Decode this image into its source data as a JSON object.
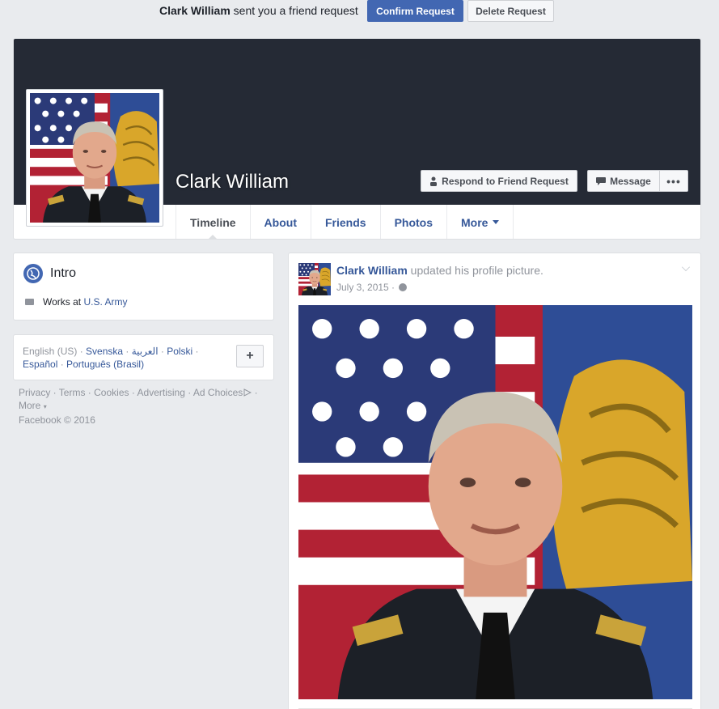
{
  "friend_request": {
    "sender": "Clark William",
    "message": " sent you a friend request",
    "confirm_label": "Confirm Request",
    "delete_label": "Delete Request"
  },
  "profile": {
    "name": "Clark William",
    "respond_label": "Respond to Friend Request",
    "message_label": "Message",
    "more_label": "•••"
  },
  "tabs": [
    {
      "label": "Timeline",
      "active": true
    },
    {
      "label": "About"
    },
    {
      "label": "Friends"
    },
    {
      "label": "Photos"
    },
    {
      "label": "More"
    }
  ],
  "intro": {
    "title": "Intro",
    "work_prefix": "Works at ",
    "work_place": "U.S. Army"
  },
  "languages": {
    "current": "English (US)",
    "links": [
      "Svenska",
      "العربية",
      "Polski",
      "Español",
      "Português (Brasil)"
    ],
    "add_label": "+"
  },
  "footer": {
    "links": [
      "Privacy",
      "Terms",
      "Cookies",
      "Advertising",
      "Ad Choices",
      "More"
    ],
    "copyright": "Facebook © 2016"
  },
  "post": {
    "author": "Clark William",
    "action": " updated his profile picture.",
    "date": "July 3, 2015",
    "date_sep": " · "
  },
  "colors": {
    "accent": "#4267b2",
    "link": "#365899",
    "cover": "#252a35",
    "background": "#e9ebee"
  }
}
